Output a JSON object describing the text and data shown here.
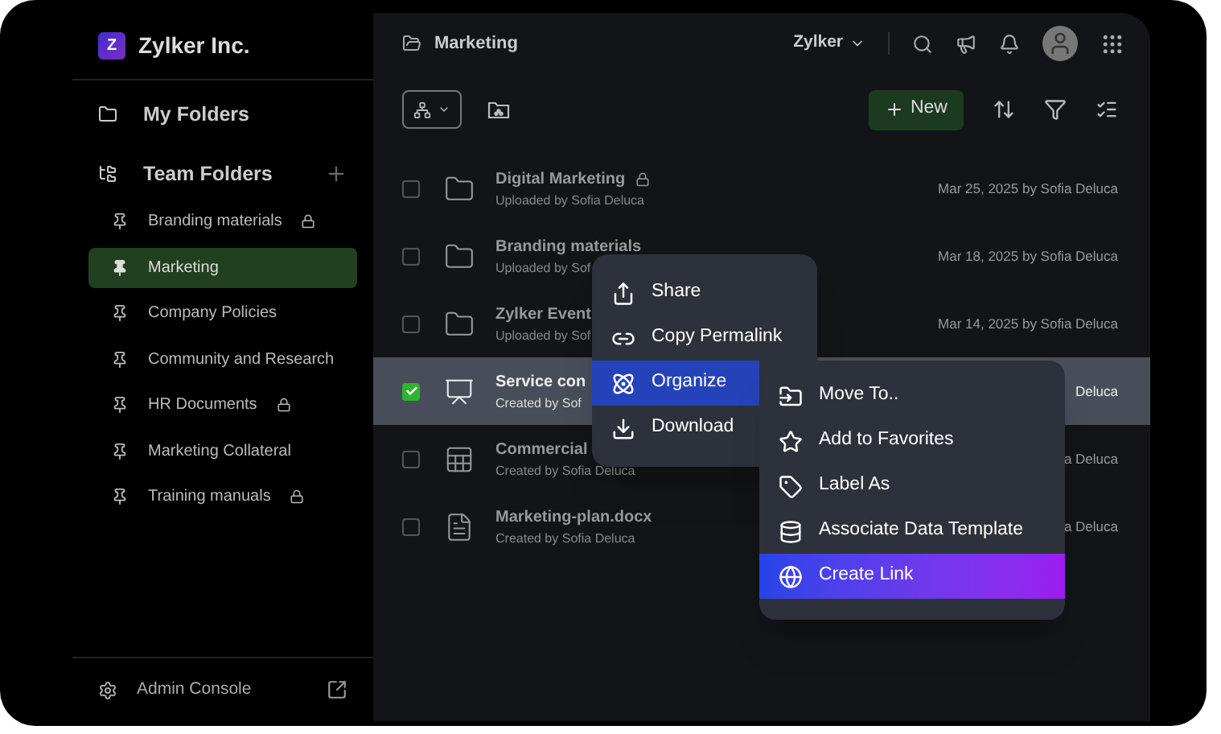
{
  "sidebar": {
    "org": {
      "initial": "Z",
      "name": "Zylker Inc."
    },
    "my_folders": {
      "label": "My Folders"
    },
    "team_folders": {
      "label": "Team Folders",
      "items": [
        {
          "label": "Branding materials",
          "locked": true,
          "selected": false
        },
        {
          "label": "Marketing",
          "locked": false,
          "selected": true
        },
        {
          "label": "Company Policies",
          "locked": false,
          "selected": false
        },
        {
          "label": "Community and Research",
          "locked": false,
          "selected": false
        },
        {
          "label": "HR Documents",
          "locked": true,
          "selected": false
        },
        {
          "label": "Marketing Collateral",
          "locked": false,
          "selected": false
        },
        {
          "label": "Training manuals",
          "locked": true,
          "selected": false
        }
      ]
    },
    "footer": {
      "label": "Admin Console"
    }
  },
  "header": {
    "title": "Marketing",
    "org_switcher": "Zylker"
  },
  "toolbar": {
    "new_button": "New"
  },
  "files": [
    {
      "kind": "folder",
      "name": "Digital Marketing",
      "locked": true,
      "subtitle": "Uploaded by Sofia Deluca",
      "date": "Mar 25, 2025 by Sofia Deluca",
      "selected": false
    },
    {
      "kind": "folder",
      "name": "Branding materials",
      "locked": false,
      "subtitle": "Uploaded by Sof",
      "date": "Mar 18, 2025 by Sofia Deluca",
      "selected": false
    },
    {
      "kind": "folder",
      "name": "Zylker Event",
      "locked": false,
      "subtitle": "Uploaded by Sof",
      "date": "Mar 14, 2025 by Sofia Deluca",
      "selected": false
    },
    {
      "kind": "presentation",
      "name": "Service con",
      "locked": false,
      "subtitle": "Created by Sof",
      "date": "Deluca",
      "selected": true
    },
    {
      "kind": "spreadsheet",
      "name": "Commercial",
      "locked": false,
      "subtitle": "Created by Sofia Deluca",
      "date": "a Deluca",
      "selected": false
    },
    {
      "kind": "document",
      "name": "Marketing-plan.docx",
      "locked": false,
      "subtitle": "Created by Sofia Deluca",
      "date": "a Deluca",
      "selected": false
    }
  ],
  "context_menu": {
    "items": [
      {
        "kind": "share",
        "label": "Share",
        "highlighted": false
      },
      {
        "kind": "link",
        "label": "Copy Permalink",
        "highlighted": false
      },
      {
        "kind": "organize",
        "label": "Organize",
        "highlighted": true
      },
      {
        "kind": "download",
        "label": "Download",
        "highlighted": false
      }
    ]
  },
  "submenu": {
    "items": [
      {
        "kind": "move",
        "label": "Move To..",
        "highlighted": false
      },
      {
        "kind": "star",
        "label": "Add to Favorites",
        "highlighted": false
      },
      {
        "kind": "label",
        "label": "Label As",
        "highlighted": false
      },
      {
        "kind": "template",
        "label": "Associate Data Template",
        "highlighted": false
      },
      {
        "kind": "globe",
        "label": "Create Link",
        "highlighted": true
      }
    ]
  }
}
